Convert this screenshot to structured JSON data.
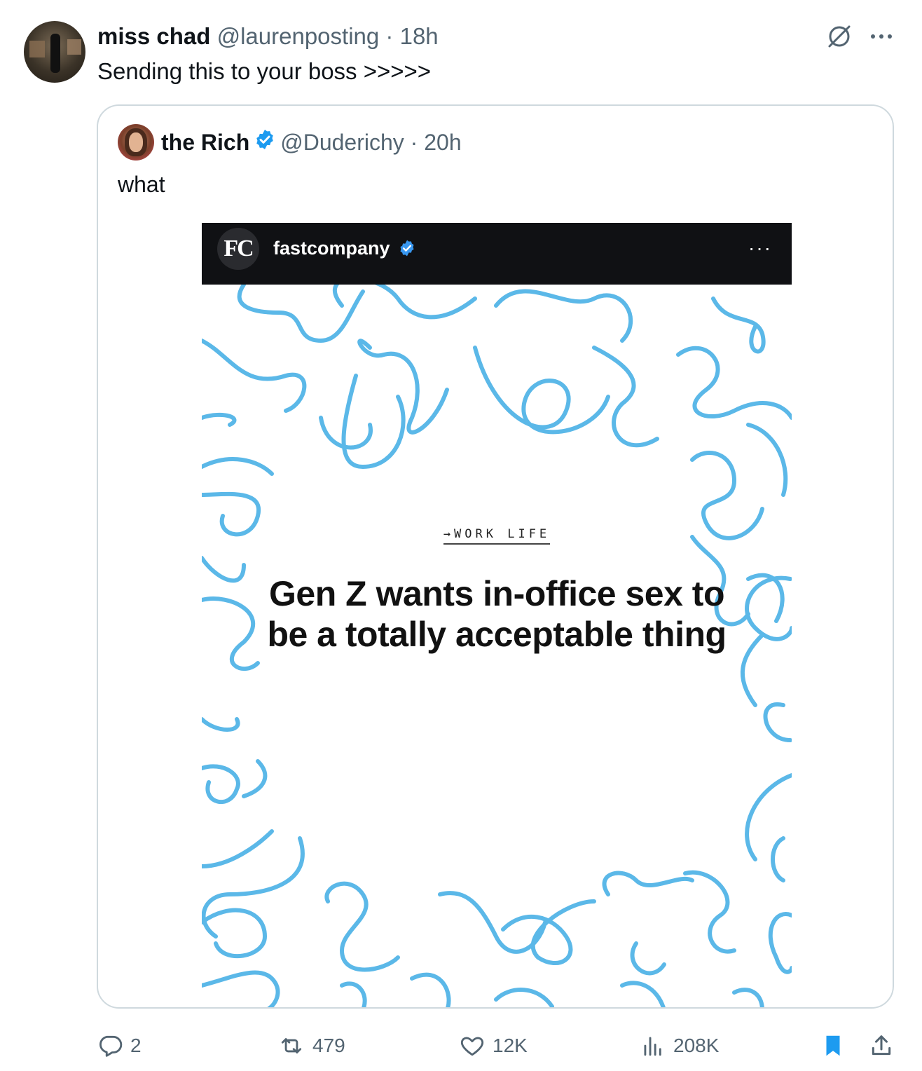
{
  "tweet": {
    "display_name": "miss chad",
    "handle": "@laurenposting",
    "separator": "·",
    "time": "18h",
    "text": "Sending this to your boss >>>>>",
    "avatar_icon": "avatar-image",
    "grok_icon": "grok-icon",
    "more_icon": "more-options-icon"
  },
  "quote": {
    "display_name": "the Rich",
    "handle": "@Duderichy",
    "separator": "·",
    "time": "20h",
    "text": "what",
    "verified_color": "#1d9bf0",
    "media": {
      "account_logo": "FC",
      "account_name": "fastcompany",
      "more_label": "···",
      "kicker": "→WORK LIFE",
      "headline": "Gen Z wants in-office sex to be a totally acceptable thing",
      "squiggle_color": "#5bb8e8"
    }
  },
  "actions": {
    "replies": "2",
    "reposts": "479",
    "likes": "12K",
    "views": "208K",
    "bookmark_color": "#1d9bf0"
  }
}
